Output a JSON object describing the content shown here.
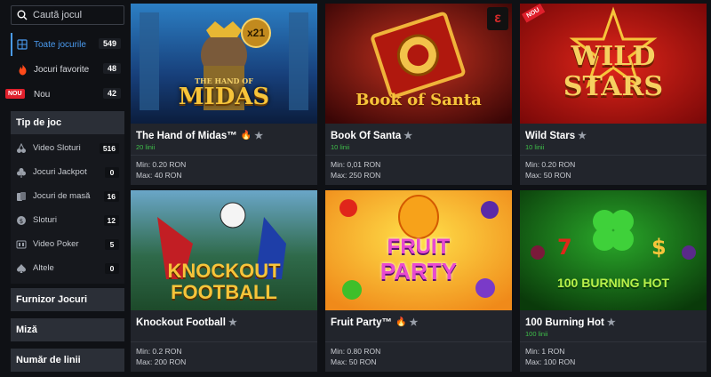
{
  "search": {
    "placeholder": "Caută jocul"
  },
  "menu": [
    {
      "label": "Toate jocurile",
      "count": "549",
      "active": true
    },
    {
      "label": "Jocuri favorite",
      "count": "48"
    },
    {
      "label": "Nou",
      "count": "42",
      "badge": "NOU"
    }
  ],
  "game_type": {
    "title": "Tip de joc",
    "items": [
      {
        "label": "Video Sloturi",
        "count": "516"
      },
      {
        "label": "Jocuri Jackpot",
        "count": "0"
      },
      {
        "label": "Jocuri de masă",
        "count": "16"
      },
      {
        "label": "Sloturi",
        "count": "12"
      },
      {
        "label": "Video Poker",
        "count": "5"
      },
      {
        "label": "Altele",
        "count": "0"
      }
    ]
  },
  "filters": {
    "providers": "Furnizor Jocuri",
    "bet": "Miză",
    "lines": "Număr de linii"
  },
  "games": [
    {
      "title": "The Hand of Midas™",
      "hot": true,
      "lines": "20 linii",
      "min": "Min: 0.20 RON",
      "max": "Max: 40 RON",
      "logo": "MIDAS",
      "logo_top": "THE HAND OF",
      "multiplier": "x21"
    },
    {
      "title": "Book Of Santa",
      "hot": false,
      "lines": "10 linii",
      "min": "Min: 0,01 RON",
      "max": "Max: 250 RON",
      "logo": "Book of Santa"
    },
    {
      "title": "Wild Stars",
      "hot": false,
      "lines": "10 linii",
      "min": "Min: 0.20 RON",
      "max": "Max: 50 RON",
      "logo": "WILD",
      "logo2": "STARS",
      "badge": "NOU"
    },
    {
      "title": "Knockout Football",
      "hot": false,
      "lines": "",
      "min": "Min: 0.2 RON",
      "max": "Max: 200 RON",
      "logo": "KNOCKOUT",
      "logo2": "FOOTBALL"
    },
    {
      "title": "Fruit Party™",
      "hot": true,
      "lines": "",
      "min": "Min: 0.80 RON",
      "max": "Max: 50 RON",
      "logo": "FRUIT",
      "logo2": "PARTY"
    },
    {
      "title": "100 Burning Hot",
      "hot": false,
      "lines": "100 linii",
      "min": "Min: 1 RON",
      "max": "Max: 100 RON",
      "logo": "100 BURNING HOT"
    }
  ],
  "colors": {
    "accent": "#4a9bf0",
    "lines_green": "#3fbf4a",
    "hot": "#ff4a1a",
    "new_badge": "#e0202c"
  },
  "icons": {
    "star": "★",
    "fire": "🔥"
  }
}
